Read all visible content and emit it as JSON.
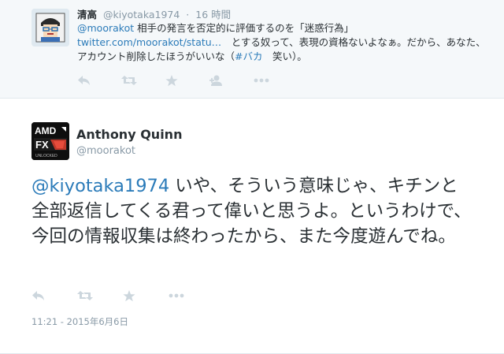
{
  "reply_tweet": {
    "display_name": "清高",
    "handle": "@kiyotaka1974",
    "separator": "·",
    "time_ago": "16 時間",
    "mention": "@moorakot",
    "text_1": " 相手の発言を否定的に評価するのを「迷惑行為」",
    "link": "twitter.com/moorakot/statu…",
    "text_2": "　とする奴って、表現の資格ないよなぁ。だから、あなた、アカウント削除したほうがいいな（",
    "hashtag": "#バカ",
    "text_3": "　笑い）。",
    "actions": [
      "reply-icon",
      "retweet-icon",
      "favorite-icon",
      "follow-icon",
      "more-icon"
    ]
  },
  "main_tweet": {
    "display_name": "Anthony Quinn",
    "handle": "@moorakot",
    "avatar_text": {
      "brand": "AMD",
      "model": "FX",
      "tag": "UNLOCKED"
    },
    "mention": "@kiyotaka1974",
    "text": " いや、そういう意味じゃ、キチンと全部返信してくる君って偉いと思うよ。というわけで、今回の情報収集は終わったから、また今度遊んでね。",
    "actions": [
      "reply-icon",
      "retweet-icon",
      "favorite-icon",
      "more-icon"
    ],
    "timestamp": "11:21 - 2015年6月6日"
  },
  "colors": {
    "link": "#2b7bb9",
    "meta": "#8899a6",
    "text": "#292f33",
    "icon": "#ccd6dd",
    "reply_bg": "#f5f8fa"
  }
}
